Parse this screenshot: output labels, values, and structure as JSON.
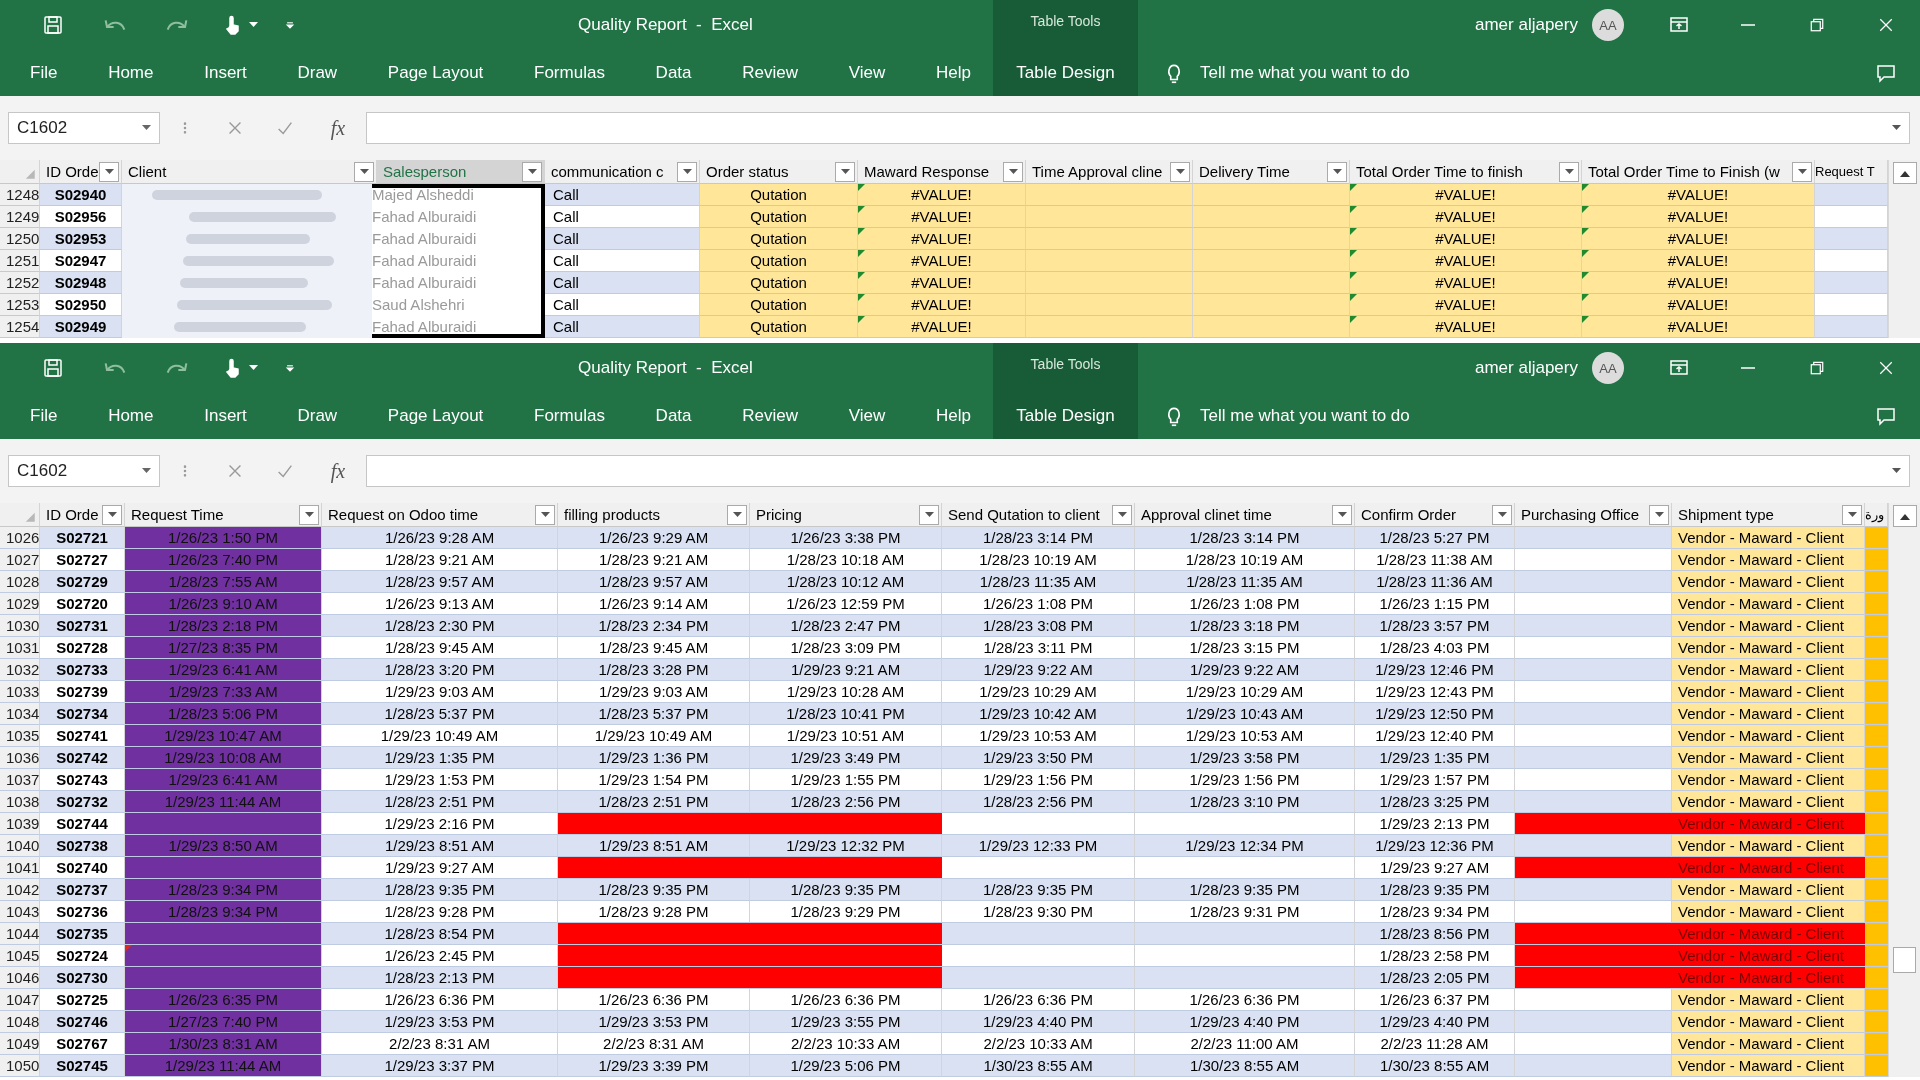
{
  "windows": [
    {
      "title_bar": {
        "title": "Quality Report  -  Excel",
        "context_label": "Table Tools",
        "user": "amer aljapery",
        "initials": "AA"
      },
      "ribbon_tabs": [
        {
          "label": "File",
          "contextual": false
        },
        {
          "label": "Home",
          "contextual": false
        },
        {
          "label": "Insert",
          "contextual": false
        },
        {
          "label": "Draw",
          "contextual": false
        },
        {
          "label": "Page Layout",
          "contextual": false
        },
        {
          "label": "Formulas",
          "contextual": false
        },
        {
          "label": "Data",
          "contextual": false
        },
        {
          "label": "Review",
          "contextual": false
        },
        {
          "label": "View",
          "contextual": false
        },
        {
          "label": "Help",
          "contextual": false
        },
        {
          "label": "Table Design",
          "contextual": true
        }
      ],
      "tell_me": "Tell me what you want to do",
      "formula_bar": {
        "name_box": "C1602",
        "function_label": "fx"
      },
      "sheet": {
        "kind": "orders",
        "columns": [
          {
            "label": "ID Orde",
            "selected": false
          },
          {
            "label": "Client",
            "selected": false
          },
          {
            "label": "Salesperson",
            "selected": true
          },
          {
            "label": "communication c",
            "selected": false
          },
          {
            "label": "Order status",
            "selected": false,
            "error_indicator": false
          },
          {
            "label": "Maward Response",
            "selected": false,
            "error_indicator": true
          },
          {
            "label": "Time Approval cline",
            "selected": false,
            "error_indicator": false
          },
          {
            "label": "Delivery Time",
            "selected": false,
            "error_indicator": false
          },
          {
            "label": "Total Order Time to finish",
            "selected": false,
            "error_indicator": true
          },
          {
            "label": "Total Order Time to Finish (w",
            "selected": false,
            "error_indicator": true
          },
          {
            "label": "Request T",
            "selected": false
          }
        ],
        "rows": [
          {
            "number": "1248",
            "id": "S02940",
            "salesperson": "Majed Alsheddi",
            "communication": "Call",
            "status": "Qutation",
            "maward_response": "#VALUE!",
            "total_time": "#VALUE!",
            "total_time_w": "#VALUE!"
          },
          {
            "number": "1249",
            "id": "S02956",
            "salesperson": "Fahad Alburaidi",
            "communication": "Call",
            "status": "Qutation",
            "maward_response": "#VALUE!",
            "total_time": "#VALUE!",
            "total_time_w": "#VALUE!"
          },
          {
            "number": "1250",
            "id": "S02953",
            "salesperson": "Fahad Alburaidi",
            "communication": "Call",
            "status": "Qutation",
            "maward_response": "#VALUE!",
            "total_time": "#VALUE!",
            "total_time_w": "#VALUE!"
          },
          {
            "number": "1251",
            "id": "S02947",
            "salesperson": "Fahad Alburaidi",
            "communication": "Call",
            "status": "Qutation",
            "maward_response": "#VALUE!",
            "total_time": "#VALUE!",
            "total_time_w": "#VALUE!"
          },
          {
            "number": "1252",
            "id": "S02948",
            "salesperson": "Fahad Alburaidi",
            "communication": "Call",
            "status": "Qutation",
            "maward_response": "#VALUE!",
            "total_time": "#VALUE!",
            "total_time_w": "#VALUE!"
          },
          {
            "number": "1253",
            "id": "S02950",
            "salesperson": "Saud Alshehri",
            "communication": "Call",
            "status": "Qutation",
            "maward_response": "#VALUE!",
            "total_time": "#VALUE!",
            "total_time_w": "#VALUE!"
          },
          {
            "number": "1254",
            "id": "S02949",
            "salesperson": "Fahad Alburaidi",
            "communication": "Call",
            "status": "Qutation",
            "maward_response": "#VALUE!",
            "total_time": "#VALUE!",
            "total_time_w": "#VALUE!"
          }
        ]
      }
    },
    {
      "title_bar": {
        "title": "Quality Report  -  Excel",
        "context_label": "Table Tools",
        "user": "amer aljapery",
        "initials": "AA"
      },
      "ribbon_tabs": [
        {
          "label": "File",
          "contextual": false
        },
        {
          "label": "Home",
          "contextual": false
        },
        {
          "label": "Insert",
          "contextual": false
        },
        {
          "label": "Draw",
          "contextual": false
        },
        {
          "label": "Page Layout",
          "contextual": false
        },
        {
          "label": "Formulas",
          "contextual": false
        },
        {
          "label": "Data",
          "contextual": false
        },
        {
          "label": "Review",
          "contextual": false
        },
        {
          "label": "View",
          "contextual": false
        },
        {
          "label": "Help",
          "contextual": false
        },
        {
          "label": "Table Design",
          "contextual": true
        }
      ],
      "tell_me": "Tell me what you want to do",
      "formula_bar": {
        "name_box": "C1602",
        "function_label": "fx"
      },
      "sheet": {
        "kind": "timeline",
        "columns": [
          {
            "label": "ID Orde"
          },
          {
            "label": "Request Time"
          },
          {
            "label": "Request on Odoo time"
          },
          {
            "label": "filling products"
          },
          {
            "label": "Pricing"
          },
          {
            "label": "Send Qutation to client"
          },
          {
            "label": "Approval clinet time"
          },
          {
            "label": "Confirm Order"
          },
          {
            "label": "Purchasing Office"
          },
          {
            "label": "Shipment type"
          },
          {
            "label": "ورة"
          }
        ],
        "rows": [
          {
            "number": "1026",
            "id": "S02721",
            "flagged": false,
            "comment": false,
            "request_time": "1/26/23 1:50 PM",
            "odoo_time": "1/26/23 9:28 AM",
            "filling": "1/26/23 9:29 AM",
            "pricing": "1/26/23 3:38 PM",
            "send_quotation": "1/28/23 3:14 PM",
            "approval": "1/28/23 3:14 PM",
            "confirm": "1/28/23 5:27 PM",
            "shipment": "Vendor - Maward - Client"
          },
          {
            "number": "1027",
            "id": "S02727",
            "flagged": false,
            "comment": false,
            "request_time": "1/26/23 7:40 PM",
            "odoo_time": "1/28/23 9:21 AM",
            "filling": "1/28/23 9:21 AM",
            "pricing": "1/28/23 10:18 AM",
            "send_quotation": "1/28/23 10:19 AM",
            "approval": "1/28/23 10:19 AM",
            "confirm": "1/28/23 11:38 AM",
            "shipment": "Vendor - Maward - Client"
          },
          {
            "number": "1028",
            "id": "S02729",
            "flagged": false,
            "comment": false,
            "request_time": "1/28/23 7:55 AM",
            "odoo_time": "1/28/23 9:57 AM",
            "filling": "1/28/23 9:57 AM",
            "pricing": "1/28/23 10:12 AM",
            "send_quotation": "1/28/23 11:35 AM",
            "approval": "1/28/23 11:35 AM",
            "confirm": "1/28/23 11:36 AM",
            "shipment": "Vendor - Maward - Client"
          },
          {
            "number": "1029",
            "id": "S02720",
            "flagged": false,
            "comment": false,
            "request_time": "1/26/23 9:10 AM",
            "odoo_time": "1/26/23 9:13 AM",
            "filling": "1/26/23 9:14 AM",
            "pricing": "1/26/23 12:59 PM",
            "send_quotation": "1/26/23 1:08 PM",
            "approval": "1/26/23 1:08 PM",
            "confirm": "1/26/23 1:15 PM",
            "shipment": "Vendor - Maward - Client"
          },
          {
            "number": "1030",
            "id": "S02731",
            "flagged": false,
            "comment": false,
            "request_time": "1/28/23 2:18 PM",
            "odoo_time": "1/28/23 2:30 PM",
            "filling": "1/28/23 2:34 PM",
            "pricing": "1/28/23 2:47 PM",
            "send_quotation": "1/28/23 3:08 PM",
            "approval": "1/28/23 3:18 PM",
            "confirm": "1/28/23 3:57 PM",
            "shipment": "Vendor - Maward - Client"
          },
          {
            "number": "1031",
            "id": "S02728",
            "flagged": false,
            "comment": false,
            "request_time": "1/27/23 8:35 PM",
            "odoo_time": "1/28/23 9:45 AM",
            "filling": "1/28/23 9:45 AM",
            "pricing": "1/28/23 3:09 PM",
            "send_quotation": "1/28/23 3:11 PM",
            "approval": "1/28/23 3:15 PM",
            "confirm": "1/28/23 4:03 PM",
            "shipment": "Vendor - Maward - Client"
          },
          {
            "number": "1032",
            "id": "S02733",
            "flagged": false,
            "comment": false,
            "request_time": "1/29/23 6:41 AM",
            "odoo_time": "1/28/23 3:20 PM",
            "filling": "1/28/23 3:28 PM",
            "pricing": "1/29/23 9:21 AM",
            "send_quotation": "1/29/23 9:22 AM",
            "approval": "1/29/23 9:22 AM",
            "confirm": "1/29/23 12:46 PM",
            "shipment": "Vendor - Maward - Client"
          },
          {
            "number": "1033",
            "id": "S02739",
            "flagged": false,
            "comment": false,
            "request_time": "1/29/23 7:33 AM",
            "odoo_time": "1/29/23 9:03 AM",
            "filling": "1/29/23 9:03 AM",
            "pricing": "1/29/23 10:28 AM",
            "send_quotation": "1/29/23 10:29 AM",
            "approval": "1/29/23 10:29 AM",
            "confirm": "1/29/23 12:43 PM",
            "shipment": "Vendor - Maward - Client"
          },
          {
            "number": "1034",
            "id": "S02734",
            "flagged": false,
            "comment": false,
            "request_time": "1/28/23 5:06 PM",
            "odoo_time": "1/28/23 5:37 PM",
            "filling": "1/28/23 5:37 PM",
            "pricing": "1/28/23 10:41 PM",
            "send_quotation": "1/29/23 10:42 AM",
            "approval": "1/29/23 10:43 AM",
            "confirm": "1/29/23 12:50 PM",
            "shipment": "Vendor - Maward - Client"
          },
          {
            "number": "1035",
            "id": "S02741",
            "flagged": false,
            "comment": false,
            "request_time": "1/29/23 10:47 AM",
            "odoo_time": "1/29/23 10:49 AM",
            "filling": "1/29/23 10:49 AM",
            "pricing": "1/29/23 10:51 AM",
            "send_quotation": "1/29/23 10:53 AM",
            "approval": "1/29/23 10:53 AM",
            "confirm": "1/29/23 12:40 PM",
            "shipment": "Vendor - Maward - Client"
          },
          {
            "number": "1036",
            "id": "S02742",
            "flagged": false,
            "comment": false,
            "request_time": "1/29/23 10:08 AM",
            "odoo_time": "1/29/23 1:35 PM",
            "filling": "1/29/23 1:36 PM",
            "pricing": "1/29/23 3:49 PM",
            "send_quotation": "1/29/23 3:50 PM",
            "approval": "1/29/23 3:58 PM",
            "confirm": "1/29/23 1:35 PM",
            "shipment": "Vendor - Maward - Client"
          },
          {
            "number": "1037",
            "id": "S02743",
            "flagged": false,
            "comment": false,
            "request_time": "1/29/23 6:41 AM",
            "odoo_time": "1/29/23 1:53 PM",
            "filling": "1/29/23 1:54 PM",
            "pricing": "1/29/23 1:55 PM",
            "send_quotation": "1/29/23 1:56 PM",
            "approval": "1/29/23 1:56 PM",
            "confirm": "1/29/23 1:57 PM",
            "shipment": "Vendor - Maward - Client"
          },
          {
            "number": "1038",
            "id": "S02732",
            "flagged": false,
            "comment": false,
            "request_time": "1/29/23 11:44 AM",
            "odoo_time": "1/28/23 2:51 PM",
            "filling": "1/28/23 2:51 PM",
            "pricing": "1/28/23 2:56 PM",
            "send_quotation": "1/28/23 2:56 PM",
            "approval": "1/28/23 3:10 PM",
            "confirm": "1/28/23 3:25 PM",
            "shipment": "Vendor - Maward - Client"
          },
          {
            "number": "1039",
            "id": "S02744",
            "flagged": true,
            "comment": false,
            "odoo_time": "1/29/23 2:16 PM",
            "confirm": "1/29/23 2:13 PM",
            "shipment": "Vendor - Maward - Client"
          },
          {
            "number": "1040",
            "id": "S02738",
            "flagged": false,
            "comment": false,
            "request_time": "1/29/23 8:50 AM",
            "odoo_time": "1/29/23 8:51 AM",
            "filling": "1/29/23 8:51 AM",
            "pricing": "1/29/23 12:32 PM",
            "send_quotation": "1/29/23 12:33 PM",
            "approval": "1/29/23 12:34 PM",
            "confirm": "1/29/23 12:36 PM",
            "shipment": "Vendor - Maward - Client"
          },
          {
            "number": "1041",
            "id": "S02740",
            "flagged": true,
            "comment": false,
            "odoo_time": "1/29/23 9:27 AM",
            "confirm": "1/29/23 9:27 AM",
            "shipment": "Vendor - Maward - Client"
          },
          {
            "number": "1042",
            "id": "S02737",
            "flagged": false,
            "comment": false,
            "request_time": "1/28/23 9:34 PM",
            "odoo_time": "1/28/23 9:35 PM",
            "filling": "1/28/23 9:35 PM",
            "pricing": "1/28/23 9:35 PM",
            "send_quotation": "1/28/23 9:35 PM",
            "approval": "1/28/23 9:35 PM",
            "confirm": "1/28/23 9:35 PM",
            "shipment": "Vendor - Maward - Client"
          },
          {
            "number": "1043",
            "id": "S02736",
            "flagged": false,
            "comment": false,
            "request_time": "1/28/23 9:34 PM",
            "odoo_time": "1/28/23 9:28 PM",
            "filling": "1/28/23 9:28 PM",
            "pricing": "1/28/23 9:29 PM",
            "send_quotation": "1/28/23 9:30 PM",
            "approval": "1/28/23 9:31 PM",
            "confirm": "1/28/23 9:34 PM",
            "shipment": "Vendor - Maward - Client"
          },
          {
            "number": "1044",
            "id": "S02735",
            "flagged": true,
            "comment": false,
            "odoo_time": "1/28/23 8:54 PM",
            "confirm": "1/28/23 8:56 PM",
            "shipment": "Vendor - Maward - Client"
          },
          {
            "number": "1045",
            "id": "S02724",
            "flagged": true,
            "comment": true,
            "odoo_time": "1/26/23 2:45 PM",
            "confirm": "1/28/23 2:58 PM",
            "shipment": "Vendor - Maward - Client"
          },
          {
            "number": "1046",
            "id": "S02730",
            "flagged": true,
            "comment": false,
            "odoo_time": "1/28/23 2:13 PM",
            "confirm": "1/28/23 2:05 PM",
            "shipment": "Vendor - Maward - Client"
          },
          {
            "number": "1047",
            "id": "S02725",
            "flagged": false,
            "comment": false,
            "request_time": "1/26/23 6:35 PM",
            "odoo_time": "1/26/23 6:36 PM",
            "filling": "1/26/23 6:36 PM",
            "pricing": "1/26/23 6:36 PM",
            "send_quotation": "1/26/23 6:36 PM",
            "approval": "1/26/23 6:36 PM",
            "confirm": "1/26/23 6:37 PM",
            "shipment": "Vendor - Maward - Client"
          },
          {
            "number": "1048",
            "id": "S02746",
            "flagged": false,
            "comment": false,
            "request_time": "1/27/23 7:40 PM",
            "odoo_time": "1/29/23 3:53 PM",
            "filling": "1/29/23 3:53 PM",
            "pricing": "1/29/23 3:55 PM",
            "send_quotation": "1/29/23 4:40 PM",
            "approval": "1/29/23 4:40 PM",
            "confirm": "1/29/23 4:40 PM",
            "shipment": "Vendor - Maward - Client"
          },
          {
            "number": "1049",
            "id": "S02767",
            "flagged": false,
            "comment": false,
            "request_time": "1/30/23 8:31 AM",
            "odoo_time": "2/2/23 8:31 AM",
            "filling": "2/2/23 8:31 AM",
            "pricing": "2/2/23 10:33 AM",
            "send_quotation": "2/2/23 10:33 AM",
            "approval": "2/2/23 11:00 AM",
            "confirm": "2/2/23 11:28 AM",
            "shipment": "Vendor - Maward - Client"
          },
          {
            "number": "1050",
            "id": "S02745",
            "flagged": false,
            "comment": false,
            "request_time": "1/29/23 11:44 AM",
            "odoo_time": "1/29/23 3:37 PM",
            "filling": "1/29/23 3:39 PM",
            "pricing": "1/29/23 5:06 PM",
            "send_quotation": "1/30/23 8:55 AM",
            "approval": "1/30/23 8:55 AM",
            "confirm": "1/30/23 8:55 AM",
            "shipment": "Vendor - Maward - Client"
          }
        ]
      }
    }
  ]
}
